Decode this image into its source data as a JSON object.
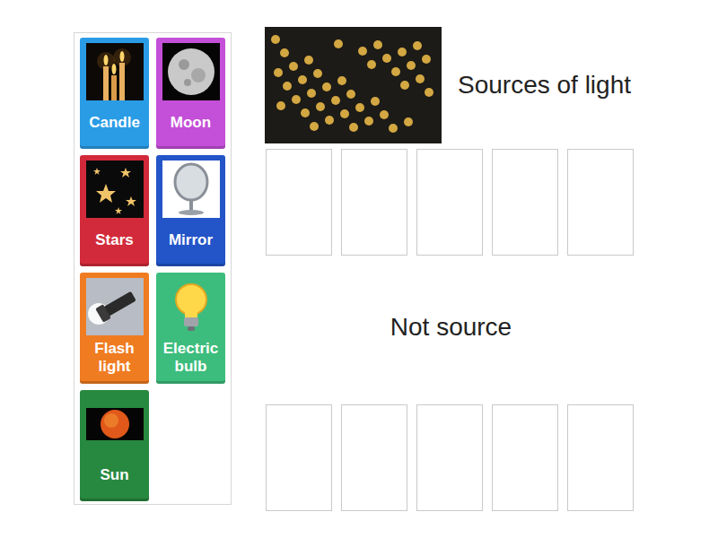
{
  "items": [
    {
      "label": "Candle",
      "color": "#2a9ce6",
      "kind": "candle"
    },
    {
      "label": "Moon",
      "color": "#c44fd8",
      "kind": "moon"
    },
    {
      "label": "Stars",
      "color": "#d22a3a",
      "kind": "stars"
    },
    {
      "label": "Mirror",
      "color": "#2354c8",
      "kind": "mirror"
    },
    {
      "label": "Flash light",
      "color": "#f07c22",
      "kind": "flashlight"
    },
    {
      "label": "Electric bulb",
      "color": "#3dbd7d",
      "kind": "bulb"
    },
    {
      "label": "Sun",
      "color": "#27893f",
      "kind": "sun"
    }
  ],
  "groups": [
    {
      "title": "Sources of light",
      "slots": [
        {
          "filled": false
        },
        {
          "filled": false
        },
        {
          "filled": false
        },
        {
          "filled": false
        },
        {
          "filled": false
        }
      ]
    },
    {
      "title": "Not source",
      "slots": [
        {
          "filled": false
        },
        {
          "filled": false
        },
        {
          "filled": false
        },
        {
          "filled": false
        },
        {
          "filled": false
        }
      ]
    }
  ]
}
